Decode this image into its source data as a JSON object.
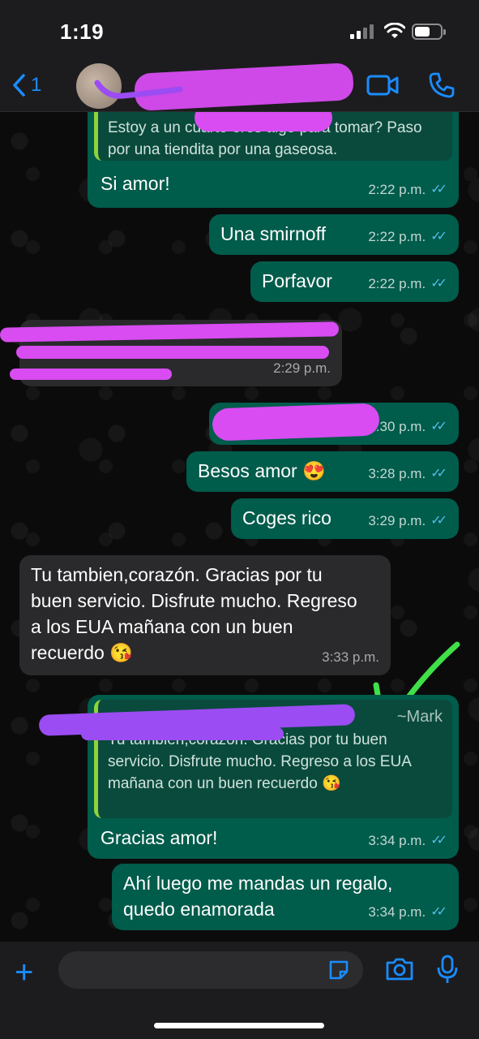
{
  "status_bar": {
    "time": "1:19"
  },
  "header": {
    "back_count": "1"
  },
  "messages": [
    {
      "quoted_text": "Estoy a un cuarto eres algo para tomar? Paso por una tiendita por una gaseosa.",
      "text": "Si amor!",
      "time": "2:22 p.m."
    },
    {
      "text": "Una smirnoff",
      "time": "2:22 p.m."
    },
    {
      "text": "Porfavor",
      "time": "2:22 p.m."
    },
    {
      "time": "2:29 p.m."
    },
    {
      "time": "2:30 p.m."
    },
    {
      "text": "Besos amor 😍",
      "time": "3:28 p.m."
    },
    {
      "text": "Coges rico",
      "time": "3:29 p.m."
    },
    {
      "text": "Tu tambien,corazón.  Gracias por tu buen servicio.  Disfrute mucho. Regreso a los EUA mañana con un buen recuerdo 😘",
      "time": "3:33 p.m."
    },
    {
      "quoted_author": "~Mark",
      "quoted_text": "Tu tambien,corazón.  Gracias por tu buen servicio.  Disfrute mucho.  Regreso a los EUA mañana con un buen recuerdo 😘",
      "text": "Gracias amor!",
      "time": "3:34 p.m."
    },
    {
      "text": "Ahí luego me mandas un regalo, quedo enamorada",
      "time": "3:34 p.m."
    }
  ],
  "icons": [
    "back-chevron-icon",
    "video-call-icon",
    "phone-icon",
    "plus-icon",
    "sticker-icon",
    "camera-icon",
    "microphone-icon",
    "read-ticks-icon"
  ],
  "colors": {
    "accent": "#1a8cff",
    "outgoing_bubble": "#005c4b",
    "incoming_bubble": "#2a2a2c",
    "read_ticks": "#53bdeb",
    "redaction": "#d84cf2",
    "annotation_check": "#3fe048"
  }
}
